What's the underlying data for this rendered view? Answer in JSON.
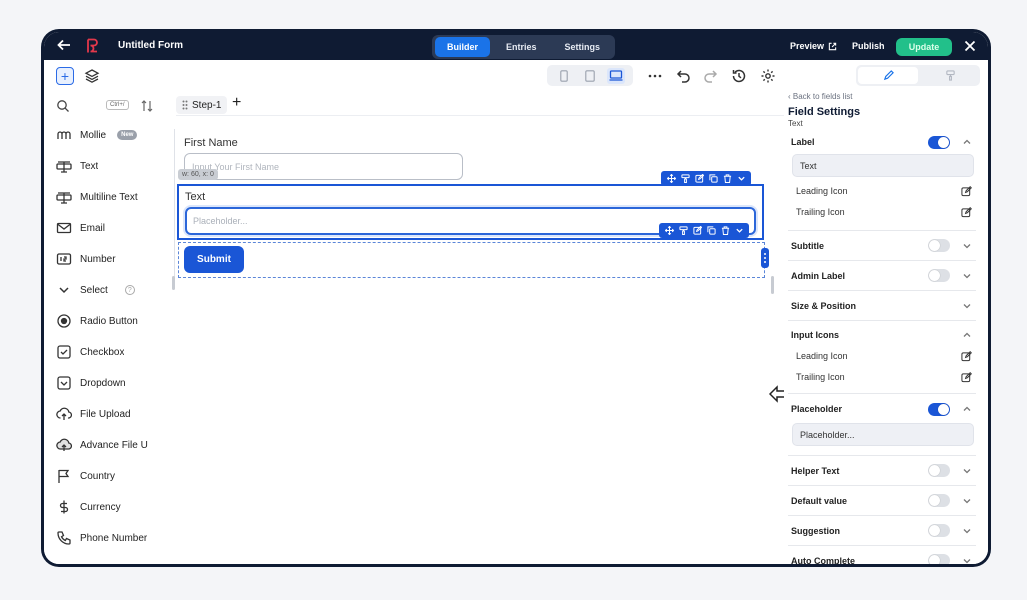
{
  "topbar": {
    "form_title": "Untitled Form",
    "tabs": [
      {
        "label": "Builder",
        "active": true
      },
      {
        "label": "Entries",
        "active": false
      },
      {
        "label": "Settings",
        "active": false
      }
    ],
    "preview_label": "Preview",
    "publish_label": "Publish",
    "update_label": "Update"
  },
  "sidebar": {
    "search_shortcut": "Ctrl+/",
    "items": [
      {
        "label": "Mollie",
        "icon": "mollie-icon",
        "badge": "New"
      },
      {
        "label": "Text",
        "icon": "text-field-icon"
      },
      {
        "label": "Multiline Text",
        "icon": "multiline-text-icon"
      },
      {
        "label": "Email",
        "icon": "email-icon"
      },
      {
        "label": "Number",
        "icon": "number-icon"
      },
      {
        "label": "Select",
        "icon": "chevron-down-icon",
        "help": "?"
      },
      {
        "label": "Radio Button",
        "icon": "radio-icon"
      },
      {
        "label": "Checkbox",
        "icon": "checkbox-icon"
      },
      {
        "label": "Dropdown",
        "icon": "dropdown-icon"
      },
      {
        "label": "File Upload",
        "icon": "upload-icon"
      },
      {
        "label": "Advance File U",
        "icon": "advance-upload-icon"
      },
      {
        "label": "Country",
        "icon": "flag-icon"
      },
      {
        "label": "Currency",
        "icon": "dollar-icon"
      },
      {
        "label": "Phone Number",
        "icon": "phone-icon"
      }
    ]
  },
  "canvas": {
    "step_label": "Step-1",
    "first_name_label": "First Name",
    "first_name_placeholder": "Input Your First Name",
    "dim_badge": "w: 60, x: 0",
    "text_label": "Text",
    "text_placeholder": "Placeholder...",
    "submit_label": "Submit"
  },
  "panel": {
    "back_link": "Back to fields list",
    "title": "Field Settings",
    "subtitle": "Text",
    "label_row": "Label",
    "label_value": "Text",
    "leading_icon": "Leading Icon",
    "trailing_icon": "Trailing Icon",
    "subtitle_row": "Subtitle",
    "admin_label_row": "Admin Label",
    "size_position_row": "Size & Position",
    "input_icons_row": "Input Icons",
    "placeholder_row": "Placeholder",
    "placeholder_value": "Placeholder...",
    "helper_text_row": "Helper Text",
    "default_value_row": "Default value",
    "suggestion_row": "Suggestion",
    "auto_complete_row": "Auto Complete"
  },
  "colors": {
    "navy": "#0f1b33",
    "accent_blue": "#1a56d6",
    "update_green": "#22c08a"
  }
}
